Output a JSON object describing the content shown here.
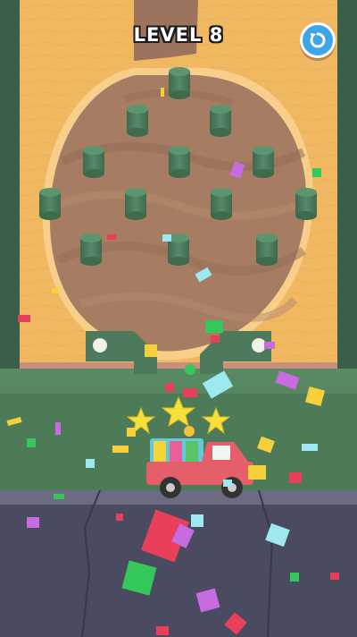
{
  "hud": {
    "level_label": "LEVEL 8",
    "restart_icon": "restart-icon"
  },
  "colors": {
    "wood": "#f1b862",
    "sand": "#a67c63",
    "sand_dark": "#8f6652",
    "pin": "#4c7a5a",
    "grass": "#3f6650",
    "road": "#4a4a60",
    "truck": "#e55f6a",
    "accent": "#3ea6e6"
  },
  "scene": {
    "objects": [
      "sand-pit",
      "peg",
      "gate",
      "ball",
      "star",
      "confetti",
      "truck",
      "road"
    ]
  }
}
